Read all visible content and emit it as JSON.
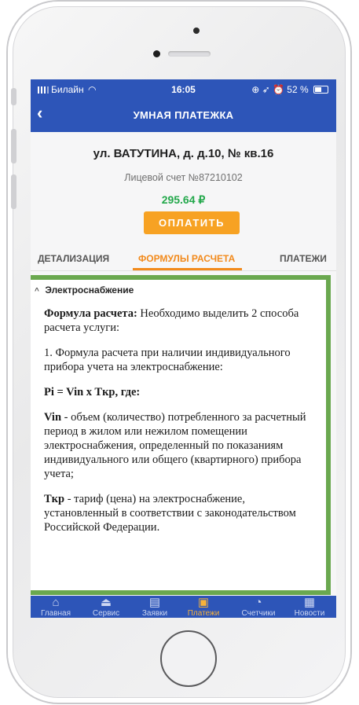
{
  "status_bar": {
    "carrier": "Билайн",
    "time": "16:05",
    "battery": "52 %"
  },
  "header": {
    "title": "УМНАЯ ПЛАТЕЖКА"
  },
  "account": {
    "address": "ул. ВАТУТИНА, д. д.10, № кв.16",
    "account_number": "Лицевой счет №87210102",
    "amount": "295.64 ₽",
    "pay_button": "ОПЛАТИТЬ"
  },
  "tabs": [
    {
      "label": "ДЕТАЛИЗАЦИЯ"
    },
    {
      "label": "ФОРМУЛЫ РАСЧЕТА"
    },
    {
      "label": "ПЛАТЕЖИ"
    }
  ],
  "section": {
    "title": "Электроснабжение",
    "p1_bold": "Формула расчета:",
    "p1_rest": " Необходимо выделить 2 способа расчета услуги:",
    "p2": "1. Формула расчета при наличии индивидуального прибора учета на электроснабжение:",
    "p3": "Pi = Vin x Tкр, где:",
    "p4_bold": "Vin",
    "p4_rest": " - объем (количество) потребленного за расчетный период в жилом или нежилом помещении электроснабжения, определенный по показаниям индивидуального или общего (квартирного) прибора учета;",
    "p5_bold": "Tкр",
    "p5_rest": " - тариф (цена) на электроснабжение, установленный в соответствии с законодательством Российской Федерации."
  },
  "bottom_nav": [
    {
      "label": "Главная",
      "icon": "home-icon"
    },
    {
      "label": "Сервис",
      "icon": "basket-icon"
    },
    {
      "label": "Заявки",
      "icon": "requests-icon"
    },
    {
      "label": "Платежи",
      "icon": "payments-icon",
      "active": true
    },
    {
      "label": "Счетчики",
      "icon": "meter-icon"
    },
    {
      "label": "Новости",
      "icon": "news-icon"
    }
  ],
  "colors": {
    "brand_blue": "#2d55b8",
    "accent_orange": "#f28a1c",
    "amount_green": "#23a84b",
    "highlight_frame": "#6aa84f"
  }
}
